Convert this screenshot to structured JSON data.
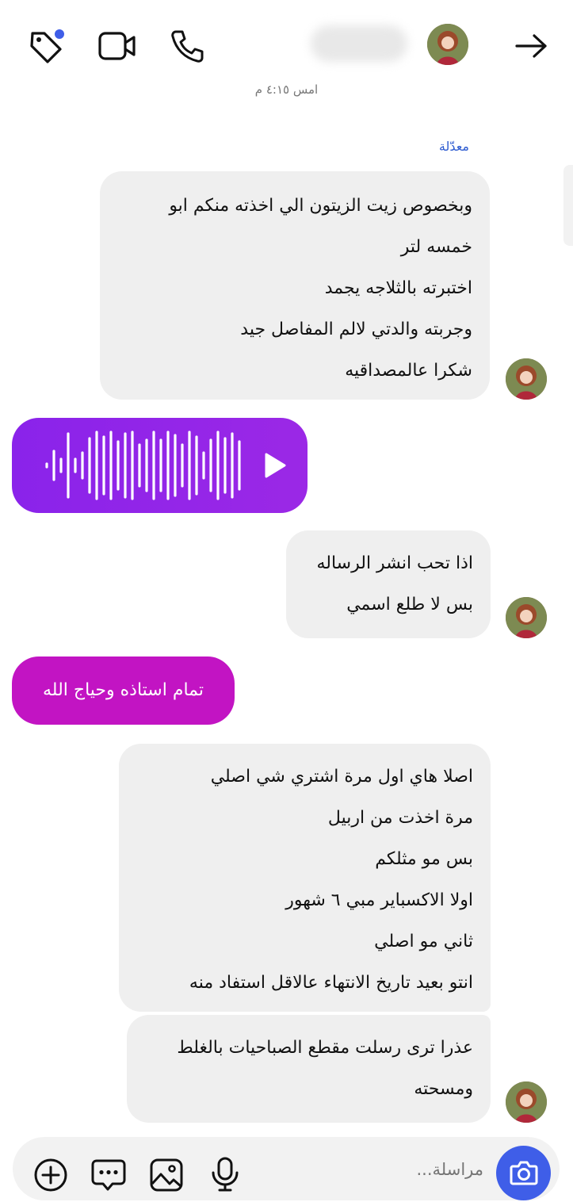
{
  "header": {
    "timestamp": "امس ٤:١٥ م",
    "icons": [
      "back-arrow-icon",
      "tag-icon",
      "video-call-icon",
      "phone-call-icon"
    ]
  },
  "thread": {
    "edited_label": "معدّلة",
    "message1": {
      "lines": [
        "وبخصوص زيت الزيتون الي اخذته منكم ابو",
        "خمسه لتر",
        "اختبرته بالثلاجه يجمد",
        "وجربته والدتي لالم المفاصل جيد",
        "شكرا عالمصداقيه"
      ]
    },
    "voice_message": {
      "icon": "play-icon",
      "color": "#8a23ea"
    },
    "message2": {
      "lines": [
        "اذا تحب انشر الرساله",
        "بس لا طلع اسمي"
      ]
    },
    "reply": {
      "text": "تمام استاذه وحياج الله",
      "color": "#c214c3"
    },
    "message3": {
      "lines": [
        "اصلا هاي اول مرة اشتري شي اصلي",
        "مرة اخذت من اربيل",
        "بس مو مثلكم",
        "اولا الاكسباير مبي ٦ شهور",
        "ثاني مو اصلي",
        "انتو بعيد تاريخ الانتهاء عالاقل استفاد منه"
      ]
    },
    "message4": {
      "lines": [
        "عذرا ترى رسلت مقطع الصباحيات بالغلط",
        "ومسحته"
      ]
    }
  },
  "composer": {
    "placeholder": "مراسلة...",
    "icons": [
      "add-icon",
      "chat-bubble-icon",
      "image-icon",
      "microphone-icon",
      "camera-icon"
    ],
    "accent": "#3f5ee8"
  }
}
